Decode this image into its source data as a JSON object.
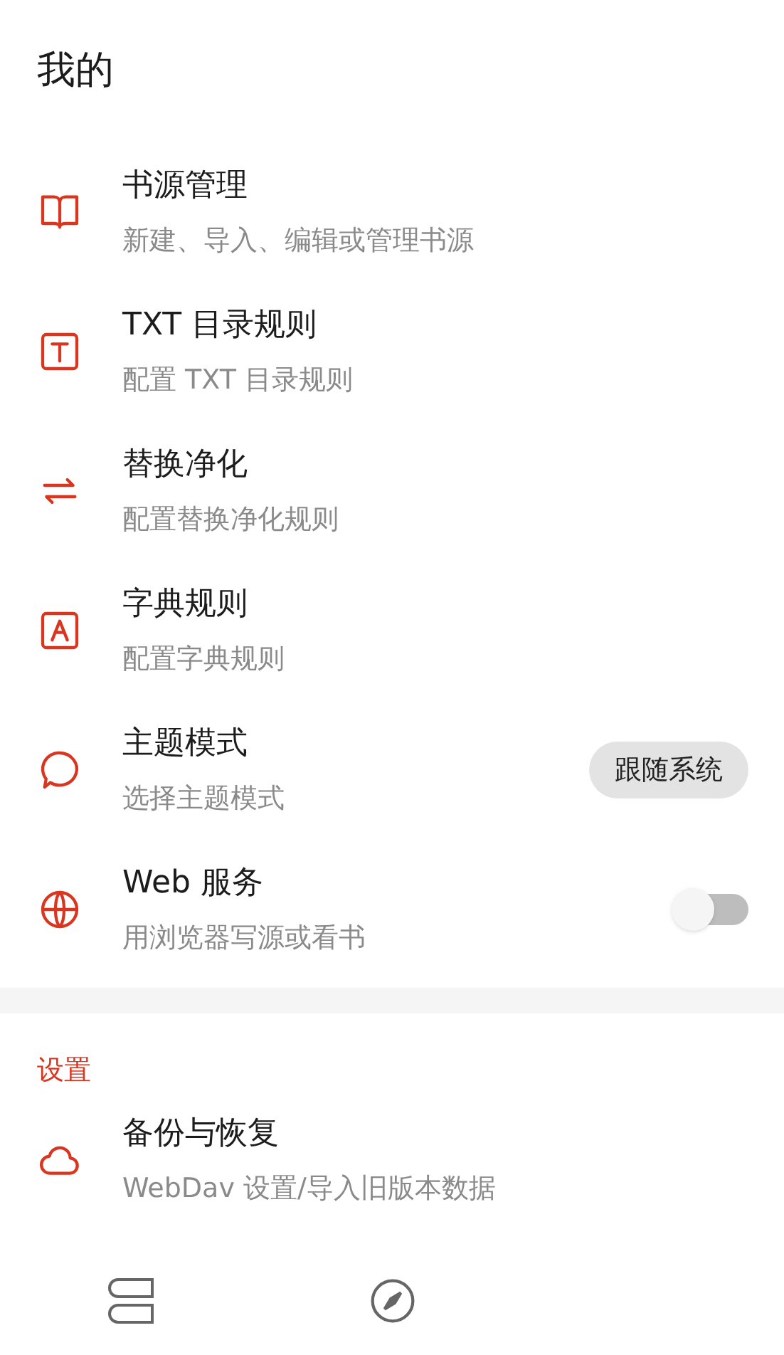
{
  "header": {
    "title": "我的"
  },
  "items": [
    {
      "kind": "plain",
      "title": "书源管理",
      "subtitle": "新建、导入、编辑或管理书源"
    },
    {
      "kind": "plain",
      "title": "TXT 目录规则",
      "subtitle": "配置 TXT 目录规则"
    },
    {
      "kind": "plain",
      "title": "替换净化",
      "subtitle": "配置替换净化规则"
    },
    {
      "kind": "plain",
      "title": "字典规则",
      "subtitle": "配置字典规则"
    },
    {
      "kind": "button",
      "title": "主题模式",
      "subtitle": "选择主题模式",
      "value": "跟随系统"
    },
    {
      "kind": "switch",
      "title": "Web 服务",
      "subtitle": "用浏览器写源或看书",
      "on": false
    }
  ],
  "settings": {
    "label": "设置",
    "items": [
      {
        "kind": "plain",
        "title": "备份与恢复",
        "subtitle": "WebDav 设置/导入旧版本数据"
      }
    ]
  }
}
